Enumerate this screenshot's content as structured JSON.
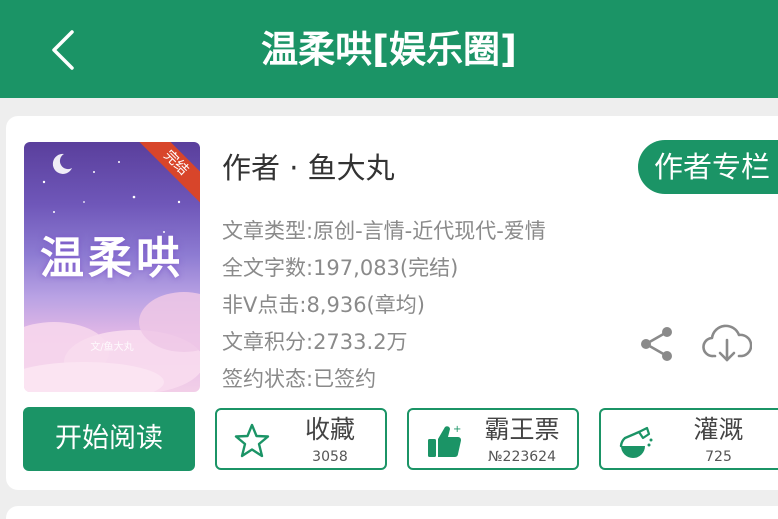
{
  "header": {
    "title": "温柔哄[娱乐圈]"
  },
  "book": {
    "cover_title": "温柔哄",
    "cover_badge": "完结",
    "cover_caption": "文/鱼大丸",
    "author": "作者 · 鱼大丸",
    "author_column_label": "作者专栏",
    "meta": {
      "type": "文章类型:原创-言情-近代现代-爱情",
      "word_count": "全文字数:197,083(完结)",
      "clicks": "非Ⅴ点击:8,936(章均)",
      "score": "文章积分:2733.2万",
      "sign_status": "签约状态:已签约"
    }
  },
  "actions": {
    "read_label": "开始阅读",
    "favorite": {
      "label": "收藏",
      "count": "3058"
    },
    "vote": {
      "label": "霸王票",
      "count": "№223624"
    },
    "water": {
      "label": "灌溉",
      "count": "725"
    }
  },
  "colors": {
    "accent": "#1b9466",
    "meta_text": "#8a8a8a",
    "badge": "#d8452a"
  },
  "icons": [
    "back-icon",
    "share-icon",
    "download-icon",
    "star-icon",
    "thumbs-up-icon",
    "watering-icon"
  ]
}
